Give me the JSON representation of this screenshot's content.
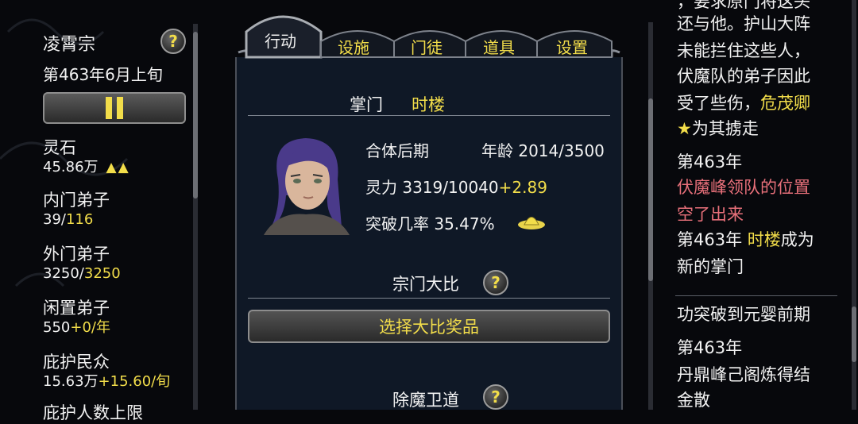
{
  "sect": {
    "name": "凌霄宗",
    "help": "?"
  },
  "date": "第463年6月上旬",
  "stats": [
    {
      "label": "灵石",
      "value": "45.86万",
      "extra": "▲▲"
    },
    {
      "label": "内门弟子",
      "value_a": "39/",
      "value_b": "116"
    },
    {
      "label": "外门弟子",
      "value_a": "3250/",
      "value_b": "3250"
    },
    {
      "label": "闲置弟子",
      "value_a": "550",
      "value_b": "+0/年"
    },
    {
      "label": "庇护民众",
      "value_a": "15.63万",
      "value_b": "+15.60/旬"
    },
    {
      "label": "庇护人数上限"
    }
  ],
  "tabs": [
    "行动",
    "设施",
    "门徒",
    "道具",
    "设置"
  ],
  "master": {
    "label": "掌门",
    "name": "时楼"
  },
  "disciple": {
    "realm": "合体后期",
    "age_label": "年龄",
    "age": "2014/3500",
    "spirit_label": "灵力",
    "spirit": "3319/10040",
    "spirit_rate": "+2.89",
    "break_label": "突破几率",
    "break_rate": "35.47%"
  },
  "sections": {
    "tournament": "宗门大比",
    "select_reward": "选择大比奖品",
    "demon_guard": "除魔卫道"
  },
  "log": [
    {
      "parts": [
        {
          "t": "，要求原门将这头",
          "c": "w"
        }
      ]
    },
    {
      "parts": [
        {
          "t": "还与他。护山大阵",
          "c": "w"
        }
      ]
    },
    {
      "parts": [
        {
          "t": "未能拦住这些人，",
          "c": "w"
        }
      ]
    },
    {
      "parts": [
        {
          "t": "伏魔队的弟子因此",
          "c": "w"
        }
      ]
    },
    {
      "parts": [
        {
          "t": "受了些伤，",
          "c": "w"
        },
        {
          "t": "危茂卿",
          "c": "y"
        }
      ]
    },
    {
      "parts": [
        {
          "t": "★",
          "c": "y"
        },
        {
          "t": "为其掳走",
          "c": "w"
        }
      ]
    },
    {
      "parts": [
        {
          "t": "第463年",
          "c": "w"
        }
      ]
    },
    {
      "parts": [
        {
          "t": "伏魔峰领队的位置",
          "c": "r"
        }
      ]
    },
    {
      "parts": [
        {
          "t": "空了出来",
          "c": "r"
        }
      ]
    },
    {
      "parts": [
        {
          "t": "第463年 ",
          "c": "w"
        },
        {
          "t": "时楼",
          "c": "y"
        },
        {
          "t": "成为",
          "c": "w"
        }
      ]
    },
    {
      "parts": [
        {
          "t": "新的掌门",
          "c": "w"
        }
      ]
    },
    {
      "parts": [
        {
          "t": "功突破到元婴前期",
          "c": "w"
        }
      ]
    },
    {
      "parts": [
        {
          "t": "第463年",
          "c": "w"
        }
      ]
    },
    {
      "parts": [
        {
          "t": "丹鼎峰己阁炼得结",
          "c": "w"
        }
      ]
    },
    {
      "parts": [
        {
          "t": "金散",
          "c": "w"
        }
      ]
    }
  ]
}
